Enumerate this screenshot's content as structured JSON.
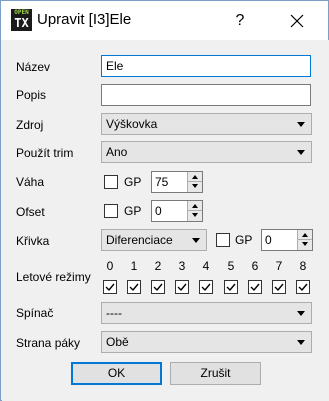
{
  "window": {
    "title": "Upravit [I3]Ele",
    "help_label": "?",
    "icon_top": "OPEN",
    "icon_bottom": "TX"
  },
  "form": {
    "name": {
      "label": "Název",
      "value": "Ele"
    },
    "description": {
      "label": "Popis",
      "value": ""
    },
    "source": {
      "label": "Zdroj",
      "value": "Výškovka"
    },
    "use_trim": {
      "label": "Použít trim",
      "value": "Ano"
    },
    "weight": {
      "label": "Váha",
      "gp_label": "GP",
      "gp_checked": false,
      "value": "75"
    },
    "offset": {
      "label": "Ofset",
      "gp_label": "GP",
      "gp_checked": false,
      "value": "0"
    },
    "curve": {
      "label": "Křivka",
      "type": "Diferenciace",
      "gp_label": "GP",
      "gp_checked": false,
      "value": "0"
    },
    "flight_modes": {
      "label": "Letové režimy",
      "modes": [
        {
          "num": "0",
          "checked": true
        },
        {
          "num": "1",
          "checked": true
        },
        {
          "num": "2",
          "checked": true
        },
        {
          "num": "3",
          "checked": true
        },
        {
          "num": "4",
          "checked": true
        },
        {
          "num": "5",
          "checked": true
        },
        {
          "num": "6",
          "checked": true
        },
        {
          "num": "7",
          "checked": true
        },
        {
          "num": "8",
          "checked": true
        }
      ]
    },
    "switch": {
      "label": "Spínač",
      "value": "----"
    },
    "stick_side": {
      "label": "Strana páky",
      "value": "Obě"
    }
  },
  "buttons": {
    "ok": "OK",
    "cancel": "Zrušit"
  }
}
